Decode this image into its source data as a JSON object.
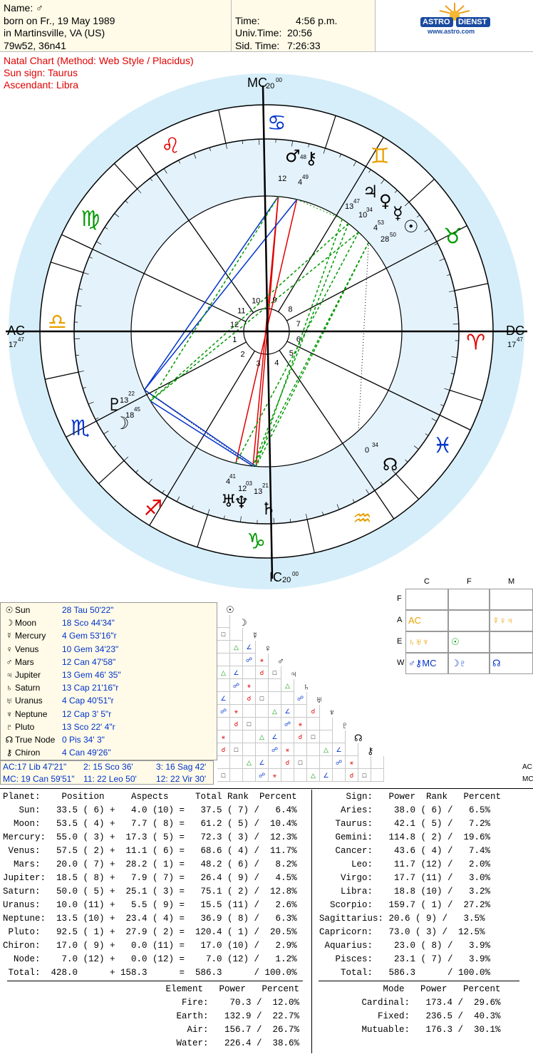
{
  "header": {
    "name_label": "Name: ♂",
    "birth_line": "born on Fr., 19 May 1989",
    "place_line": "in Martinsville, VA (US)",
    "coords_line": "79w52, 36n41",
    "time_label": "Time:",
    "time_value": "4:56 p.m.",
    "univ_label": "Univ.Time:",
    "univ_value": "20:56",
    "sid_label": "Sid. Time:",
    "sid_value": "7:26:33",
    "logo_left": "ASTRO",
    "logo_right": "DIENST",
    "logo_url": "www.astro.com"
  },
  "chart_info": {
    "title": "Natal Chart  (Method: Web Style / Placidus)",
    "sun_sign": "Sun sign: Taurus",
    "ascendant": "Ascendant: Libra"
  },
  "wheel": {
    "mc_label": "MC",
    "mc_deg": "20",
    "mc_min": "00",
    "ic_label": "IC",
    "ic_deg": "20",
    "ic_min": "00",
    "ac_label": "AC",
    "ac_deg": "17",
    "ac_min": "47",
    "dc_label": "DC",
    "dc_deg": "17",
    "dc_min": "47",
    "house_numbers": [
      "1",
      "2",
      "3",
      "4",
      "5",
      "6",
      "7",
      "8",
      "9",
      "10",
      "11",
      "12"
    ],
    "sign_glyphs": [
      "♈",
      "♉",
      "♊",
      "♋",
      "♌",
      "♍",
      "♎",
      "♏",
      "♐",
      "♑",
      "♒",
      "♓"
    ],
    "planet_labels": [
      {
        "glyph": "♂",
        "deg": "12",
        "min": "48"
      },
      {
        "glyph": "⚷",
        "deg": "4",
        "min": "49"
      },
      {
        "glyph": "♃",
        "deg": "13",
        "min": "47"
      },
      {
        "glyph": "♀",
        "deg": "10",
        "min": "34"
      },
      {
        "glyph": "☿",
        "deg": "4",
        "min": "53"
      },
      {
        "glyph": "☉",
        "deg": "28",
        "min": "50"
      },
      {
        "glyph": "♇",
        "deg": "13",
        "min": "22"
      },
      {
        "glyph": "☽",
        "deg": "18",
        "min": "45"
      },
      {
        "glyph": "♅",
        "deg": "4",
        "min": "41"
      },
      {
        "glyph": "♆",
        "deg": "12",
        "min": "03"
      },
      {
        "glyph": "♄",
        "deg": "13",
        "min": "21"
      },
      {
        "glyph": "☊",
        "deg": "0",
        "min": "34"
      }
    ]
  },
  "planets_table": [
    {
      "glyph": "☉",
      "name": "Sun",
      "pos": "28 Tau 50'22\""
    },
    {
      "glyph": "☽",
      "name": "Moon",
      "pos": "18 Sco 44'34\""
    },
    {
      "glyph": "☿",
      "name": "Mercury",
      "pos": "4 Gem 53'16\"r"
    },
    {
      "glyph": "♀",
      "name": "Venus",
      "pos": "10 Gem 34'23\""
    },
    {
      "glyph": "♂",
      "name": "Mars",
      "pos": "12 Can 47'58\""
    },
    {
      "glyph": "♃",
      "name": "Jupiter",
      "pos": "13 Gem 46' 35\""
    },
    {
      "glyph": "♄",
      "name": "Saturn",
      "pos": "13 Cap 21'16\"r"
    },
    {
      "glyph": "♅",
      "name": "Uranus",
      "pos": "4 Cap 40'51\"r"
    },
    {
      "glyph": "♆",
      "name": "Neptune",
      "pos": "12 Cap  3'  5\"r"
    },
    {
      "glyph": "♇",
      "name": "Pluto",
      "pos": "13 Sco 22'  4\"r"
    },
    {
      "glyph": "☊",
      "name": "True Node",
      "pos": "0  Pis 34'  3\""
    },
    {
      "glyph": "⚷",
      "name": "Chiron",
      "pos": "4 Can 49'26\""
    }
  ],
  "houses": {
    "ac": "AC:17  Lib 47'21\"",
    "h2": "2: 15 Sco 36'",
    "h3": "3: 16 Sag 42'",
    "mc": "MC: 19 Can 59'51\"",
    "h11": "11: 22  Leo 50'",
    "h12": "12: 22  Vir  30'"
  },
  "element_grid": {
    "col_labels": [
      "C",
      "F",
      "M"
    ],
    "row_labels": [
      "F",
      "A",
      "E",
      "W"
    ],
    "cells": [
      [
        "",
        "",
        ""
      ],
      [
        "AC",
        "",
        "☿♀♃"
      ],
      [
        "♄♅♆",
        "☉",
        ""
      ],
      [
        "♂⚷MC",
        "☽♇",
        "☊"
      ]
    ]
  },
  "planet_stats": {
    "header": "Planet:    Position     Aspects     Total Rank  Percent",
    "rows": [
      "   Sun:   33.5 ( 6) +   4.0 (10) =   37.5 ( 7) /   6.4%",
      "  Moon:   53.5 ( 4) +   7.7 ( 8) =   61.2 ( 5) /  10.4%",
      "Mercury:  55.0 ( 3) +  17.3 ( 5) =   72.3 ( 3) /  12.3%",
      " Venus:   57.5 ( 2) +  11.1 ( 6) =   68.6 ( 4) /  11.7%",
      "  Mars:   20.0 ( 7) +  28.2 ( 1) =   48.2 ( 6) /   8.2%",
      "Jupiter:  18.5 ( 8) +   7.9 ( 7) =   26.4 ( 9) /   4.5%",
      "Saturn:   50.0 ( 5) +  25.1 ( 3) =   75.1 ( 2) /  12.8%",
      "Uranus:   10.0 (11) +   5.5 ( 9) =   15.5 (11) /   2.6%",
      "Neptune:  13.5 (10) +  23.4 ( 4) =   36.9 ( 8) /   6.3%",
      " Pluto:   92.5 ( 1) +  27.9 ( 2) =  120.4 ( 1) /  20.5%",
      "Chiron:   17.0 ( 9) +   0.0 (11) =   17.0 (10) /   2.9%",
      "  Node:    7.0 (12) +   0.0 (12) =    7.0 (12) /   1.2%",
      " Total:  428.0      + 158.3      =  586.3      / 100.0%"
    ]
  },
  "sign_stats": {
    "header": "     Sign:   Power  Rank   Percent",
    "rows": [
      "    Aries:    38.0 ( 6) /   6.5%",
      "   Taurus:    42.1 ( 5) /   7.2%",
      "   Gemini:   114.8 ( 2) /  19.6%",
      "   Cancer:    43.6 ( 4) /   7.4%",
      "      Leo:    11.7 (12) /   2.0%",
      "    Virgo:    17.7 (11) /   3.0%",
      "    Libra:    18.8 (10) /   3.2%",
      "  Scorpio:   159.7 ( 1) /  27.2%",
      "Sagittarius: 20.6 ( 9) /   3.5%",
      "Capricorn:   73.0 ( 3) /  12.5%",
      " Aquarius:    23.0 ( 8) /   3.9%",
      "   Pisces:    23.1 ( 7) /   3.9%",
      "    Total:   586.3      / 100.0%"
    ]
  },
  "element_stats": {
    "header": " Element   Power   Percent",
    "rows": [
      "    Fire:    70.3 /  12.0%",
      "   Earth:   132.9 /  22.7%",
      "     Air:   156.7 /  26.7%",
      "   Water:   226.4 /  38.6%"
    ]
  },
  "mode_stats": {
    "header": "     Mode   Power   Percent",
    "rows": [
      " Cardinal:   173.4 /  29.6%",
      "    Fixed:   236.5 /  40.3%",
      " Mutuable:   176.3 /  30.1%"
    ]
  },
  "colors": {
    "accent_red": "#e00000",
    "accent_blue": "#0033cc",
    "accent_green": "#009900",
    "ring_blue": "#cfe9f7",
    "panel_beige": "#fffbe8"
  }
}
